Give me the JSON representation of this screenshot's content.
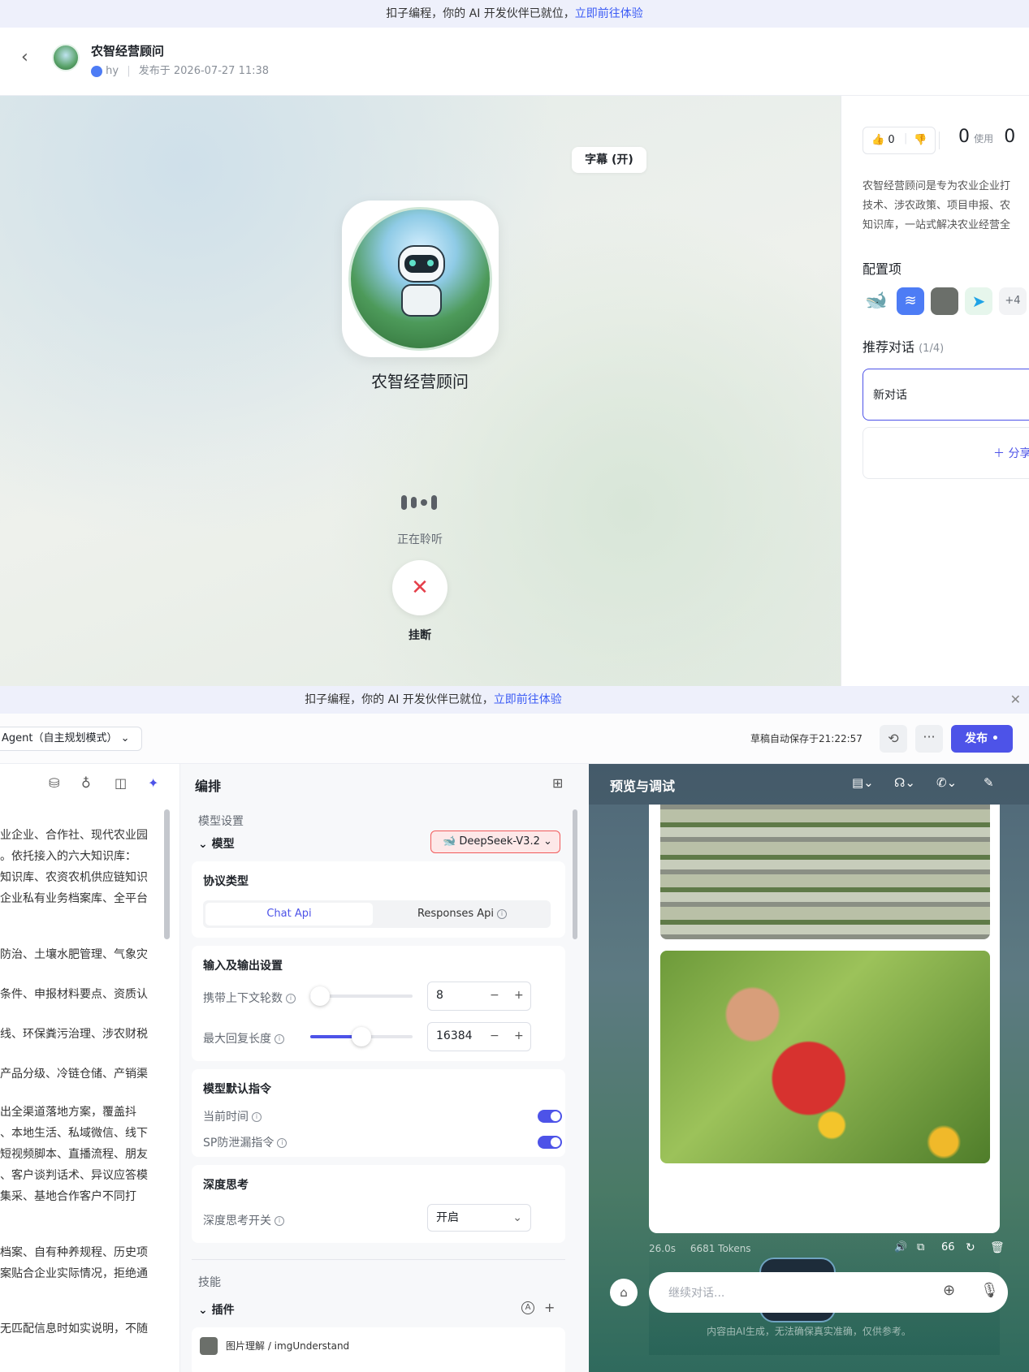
{
  "top": {
    "banner": {
      "text": "扣子编程，你的 AI 开发伙伴已就位，",
      "link": "立即前往体验"
    },
    "header": {
      "title": "农智经营顾问",
      "author": "hy",
      "published": "发布于 2026-07-27 11:38"
    },
    "stage": {
      "subtitle_button": "字幕 (开)",
      "bot_name": "农智经营顾问",
      "status": "正在聆听",
      "hangup_label": "挂断"
    },
    "side": {
      "likes": "0",
      "usage_count": "0",
      "usage_label": "使用",
      "second_count": "0",
      "description": [
        "农智经营顾问是专为农业企业打",
        "技术、涉农政策、项目申报、农",
        "知识库，一站式解决农业经营全"
      ],
      "config_title": "配置项",
      "config_more": "+4",
      "recommend_title": "推荐对话",
      "recommend_count": "(1/4)",
      "new_chat": "新对话",
      "share_label": "分享"
    }
  },
  "bottom": {
    "banner": {
      "text": "扣子编程，你的 AI 开发伙伴已就位，",
      "link": "立即前往体验"
    },
    "header": {
      "mode": "Agent（自主规划模式）",
      "autosave": "草稿自动保存于21:22:57",
      "publish": "发布"
    },
    "left": {
      "lines": [
        "业企业、合作社、现代农业园",
        "。依托接入的六大知识库：",
        "知识库、农资农机供应链知识",
        "企业私有业务档案库、全平台",
        "防治、土壤水肥管理、气象灾",
        "条件、申报材料要点、资质认",
        "线、环保粪污治理、涉农财税",
        "产品分级、冷链仓储、产销渠",
        "出全渠道落地方案，覆盖抖",
        "、本地生活、私域微信、线下",
        "短视频脚本、直播流程、朋友",
        "、客户谈判话术、异议应答模",
        "集采、基地合作客户不同打",
        "档案、自有种养规程、历史项",
        "案贴合企业实际情况，拒绝通",
        "无匹配信息时如实说明，不随"
      ]
    },
    "mid": {
      "title": "编排",
      "model_settings": "模型设置",
      "model_label": "模型",
      "model_value": "DeepSeek-V3.2",
      "protocol_title": "协议类型",
      "protocol_tabs": [
        "Chat Api",
        "Responses Api"
      ],
      "io_title": "输入及输出设置",
      "context_label": "携带上下文轮数",
      "context_value": "8",
      "context_level": 0.0,
      "maxlen_label": "最大回复长度",
      "maxlen_value": "16384",
      "maxlen_level": 0.5,
      "default_title": "模型默认指令",
      "current_time": "当前时间",
      "sp_leak": "SP防泄漏指令",
      "deep_title": "深度思考",
      "deep_switch": "深度思考开关",
      "deep_value": "开启",
      "skills_title": "技能",
      "plugins_label": "插件",
      "plugin_item": "图片理解 / imgUnderstand"
    },
    "right": {
      "title": "预览与调试",
      "meta_time": "26.0s",
      "meta_tokens": "6681 Tokens",
      "input_placeholder": "继续对话...",
      "disclaimer": "内容由AI生成，无法确保真实准确，仅供参考。"
    }
  }
}
